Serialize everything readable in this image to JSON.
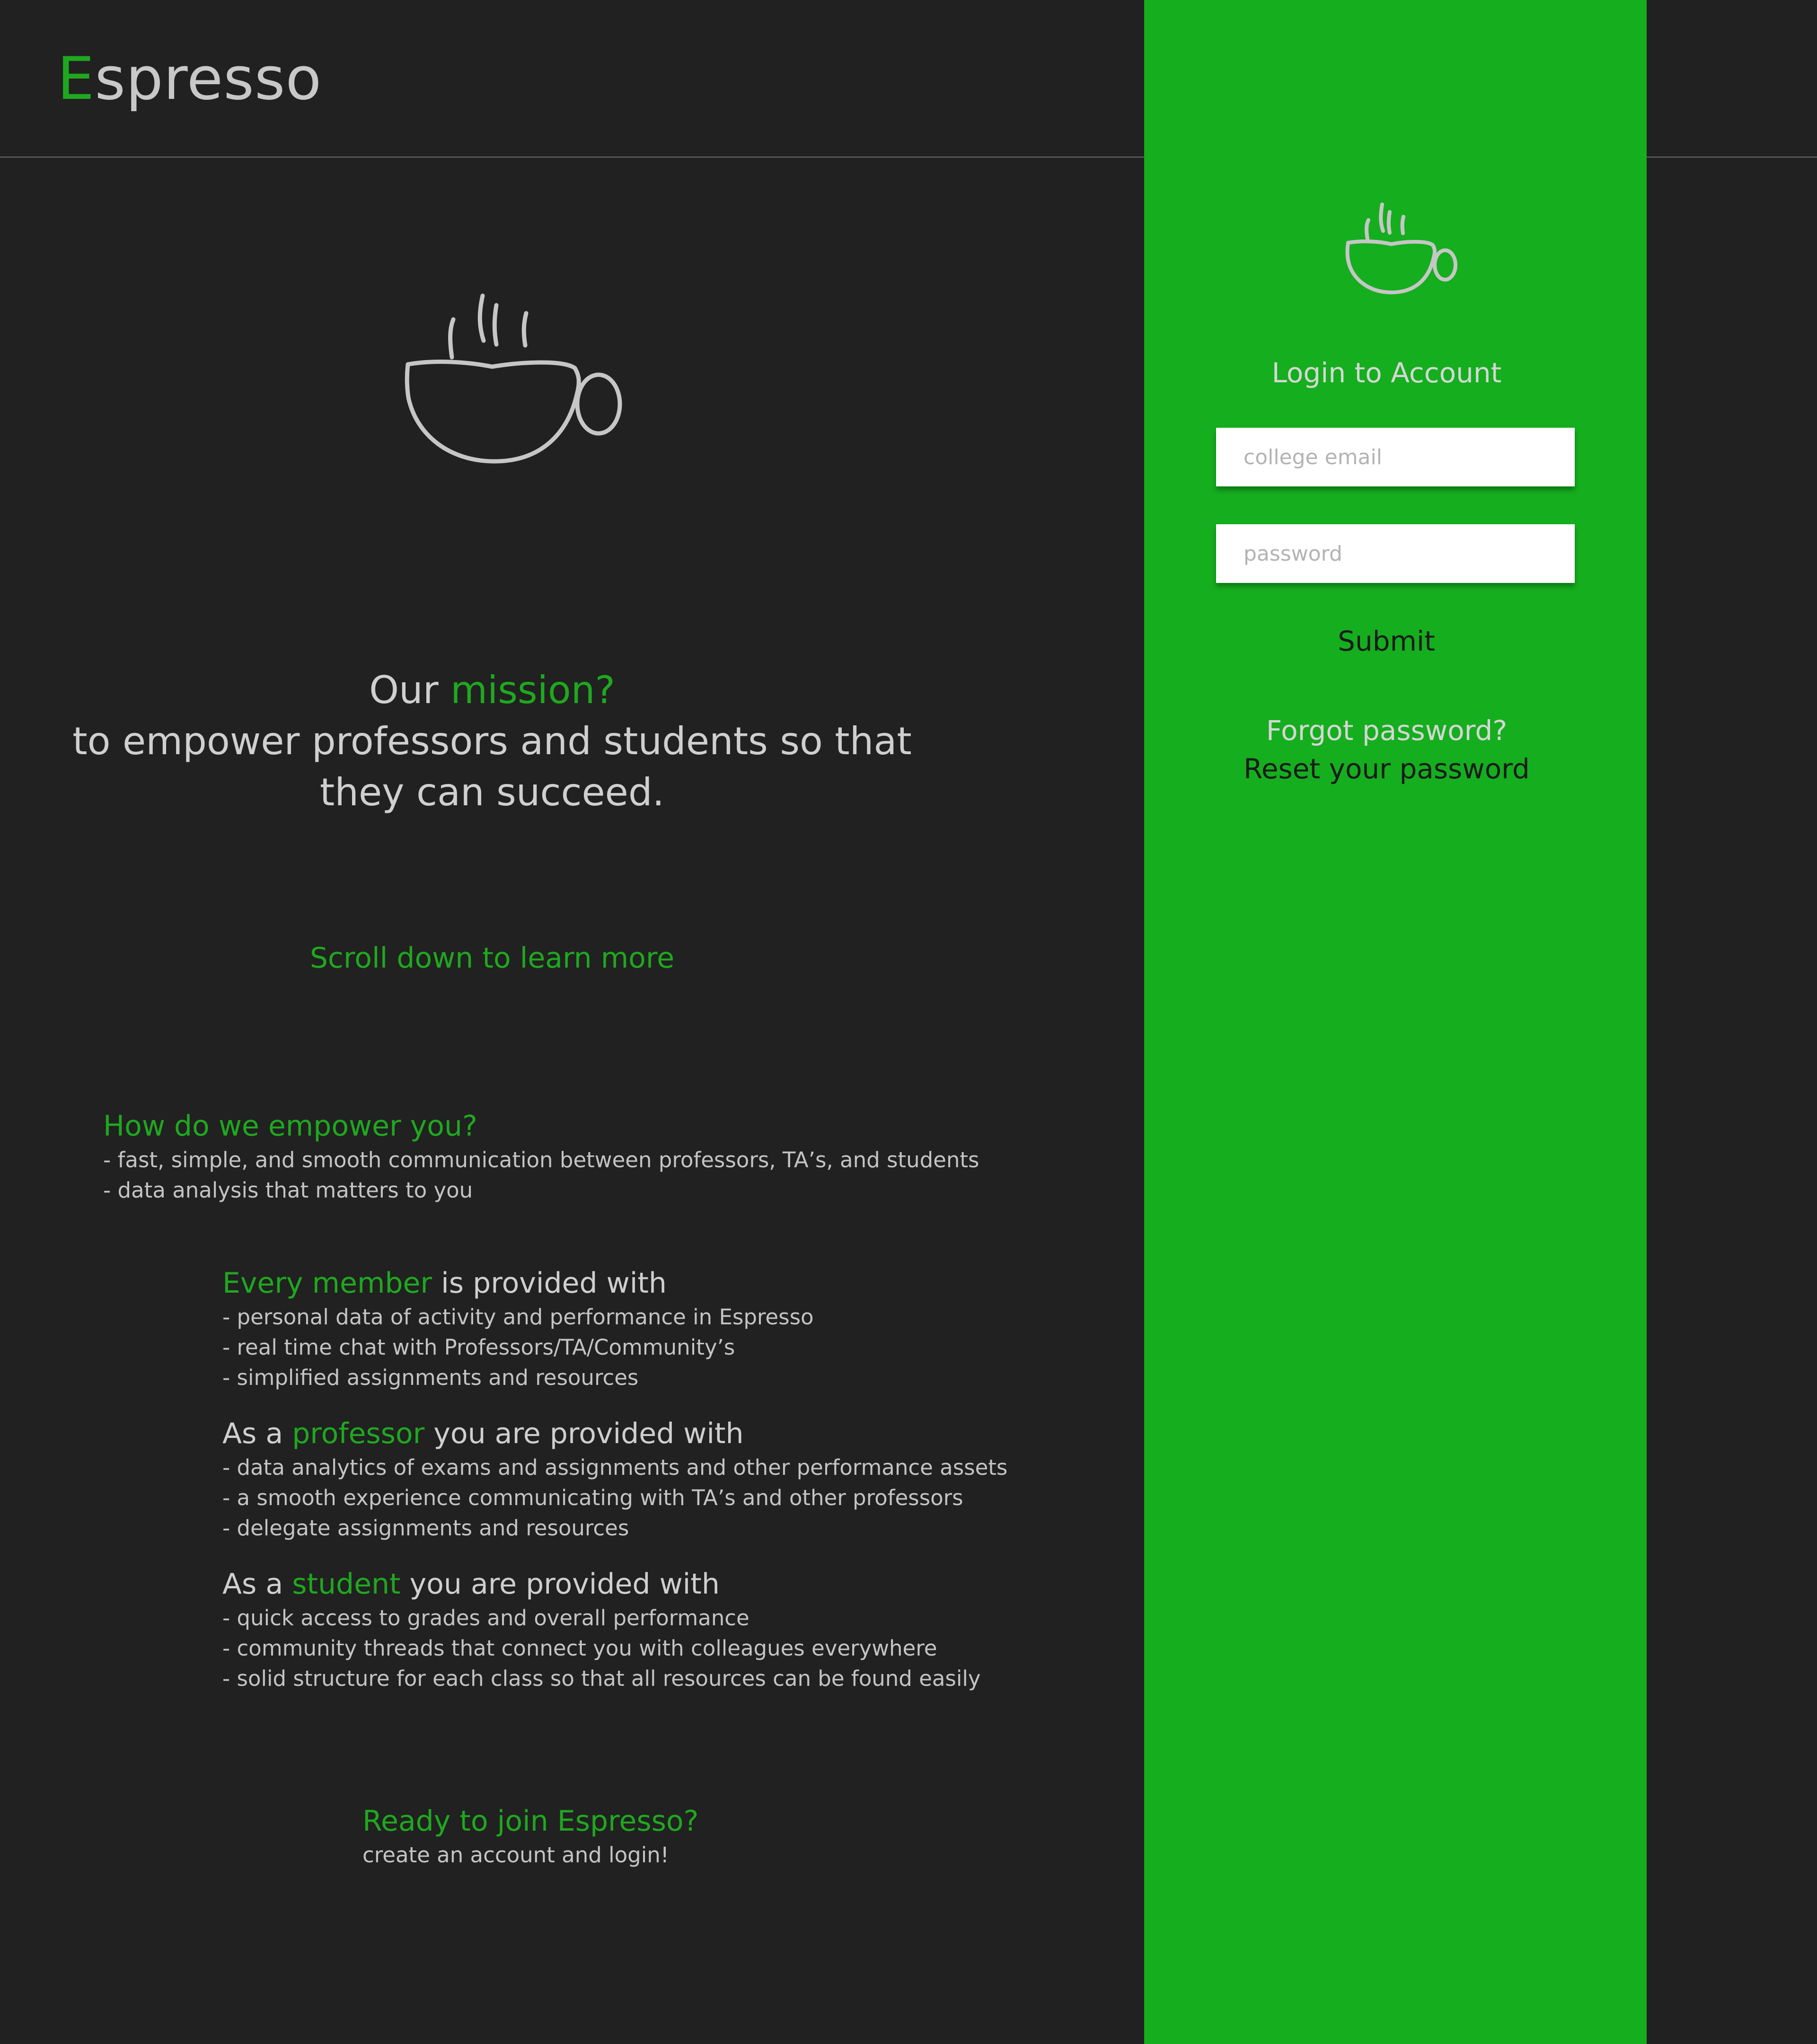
{
  "brand": {
    "first_letter": "E",
    "rest": "spresso"
  },
  "hero": {
    "icon": "coffee-cup-icon",
    "mission_prefix": "Our",
    "mission_highlight": "mission?",
    "mission_line_2": "to empower professors and students so that",
    "mission_line_3": "they can succeed.",
    "scroll_hint": "Scroll down to learn more"
  },
  "empower": {
    "heading": "How do we empower you?",
    "items": [
      "- fast, simple, and smooth communication between professors, TA’s, and students",
      "- data analysis that matters to you"
    ]
  },
  "roles": [
    {
      "prefix": "",
      "highlight": "Every member",
      "suffix": " is provided with",
      "items": [
        "- personal data of activity and performance in Espresso",
        "- real time chat with Professors/TA/Community’s",
        "- simplified assignments and resources"
      ]
    },
    {
      "prefix": "As a ",
      "highlight": "professor",
      "suffix": " you are provided with",
      "items": [
        "- data analytics of exams and assignments and other performance assets",
        "- a smooth experience communicating with TA’s and other professors",
        "- delegate assignments and resources"
      ]
    },
    {
      "prefix": "As a ",
      "highlight": "student",
      "suffix": " you are provided with",
      "items": [
        "- quick access to grades and overall performance",
        "- community threads that connect you with colleagues everywhere",
        "- solid structure for each class so that all resources can be found easily"
      ]
    }
  ],
  "join": {
    "heading": "Ready to join Espresso?",
    "subtext": "create an account and login!"
  },
  "login": {
    "icon": "coffee-cup-icon",
    "title": "Login to Account",
    "email": {
      "placeholder": "college email",
      "value": ""
    },
    "password": {
      "placeholder": "password",
      "value": ""
    },
    "submit_label": "Submit",
    "forgot_label": "Forgot password?",
    "reset_link": "Reset your password"
  },
  "colors": {
    "background": "#212121",
    "accent": "#1fa81f",
    "panel": "#15ae1e",
    "text": "#cfcfcf"
  }
}
